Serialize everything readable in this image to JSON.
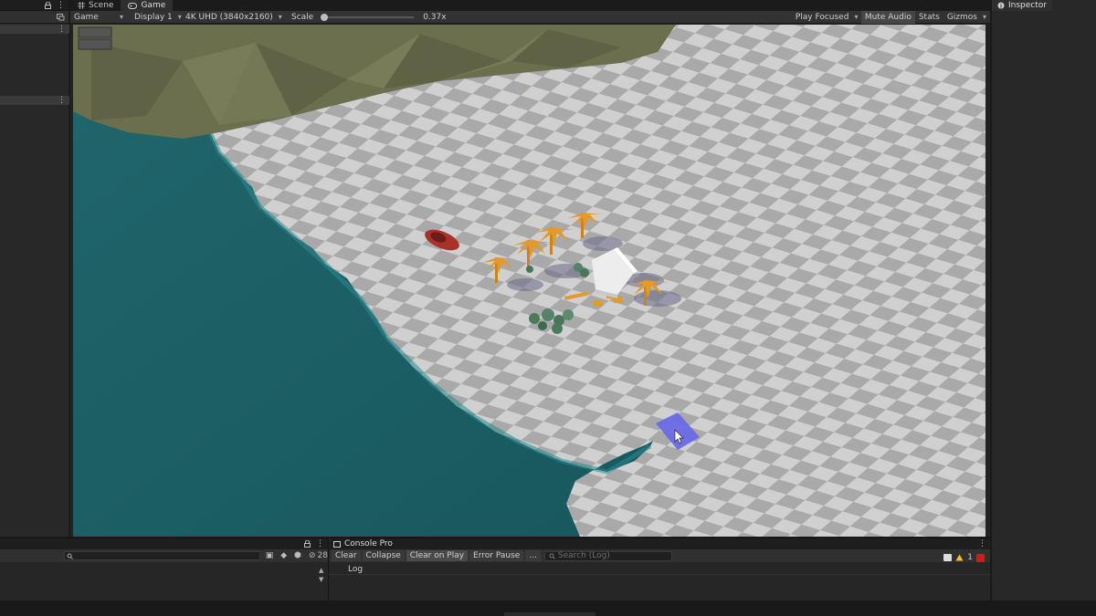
{
  "tabs": {
    "scene": "Scene",
    "game": "Game",
    "inspector": "Inspector",
    "console": "Console Pro"
  },
  "toolbar": {
    "view_mode": "Game",
    "display": "Display 1",
    "resolution": "4K UHD (3840x2160)",
    "scale_label": "Scale",
    "scale_value": "0.37x",
    "play_focused": "Play Focused",
    "mute_audio": "Mute Audio",
    "stats": "Stats",
    "gizmos": "Gizmos"
  },
  "project": {
    "hidden_count": "28"
  },
  "console": {
    "buttons": [
      "Clear",
      "Collapse",
      "Clear on Play",
      "Error Pause",
      "..."
    ],
    "search_placeholder": "Search (Log)",
    "warning_count": "1",
    "log_header": "Log"
  },
  "colors": {
    "water": "#1c6a70",
    "hill": "#6b6f4e",
    "checker_light": "#d0d0d0",
    "checker_dark": "#a9a9a9",
    "selection_tile": "#6a6ae6",
    "palm": "#e39a2a",
    "house": "#ededed",
    "car": "#c0352c"
  },
  "icons": [
    "lock-icon",
    "kebab-menu-icon",
    "search-icon",
    "gamepad-icon",
    "grid-icon",
    "warning-icon",
    "error-icon",
    "cursor-icon"
  ]
}
